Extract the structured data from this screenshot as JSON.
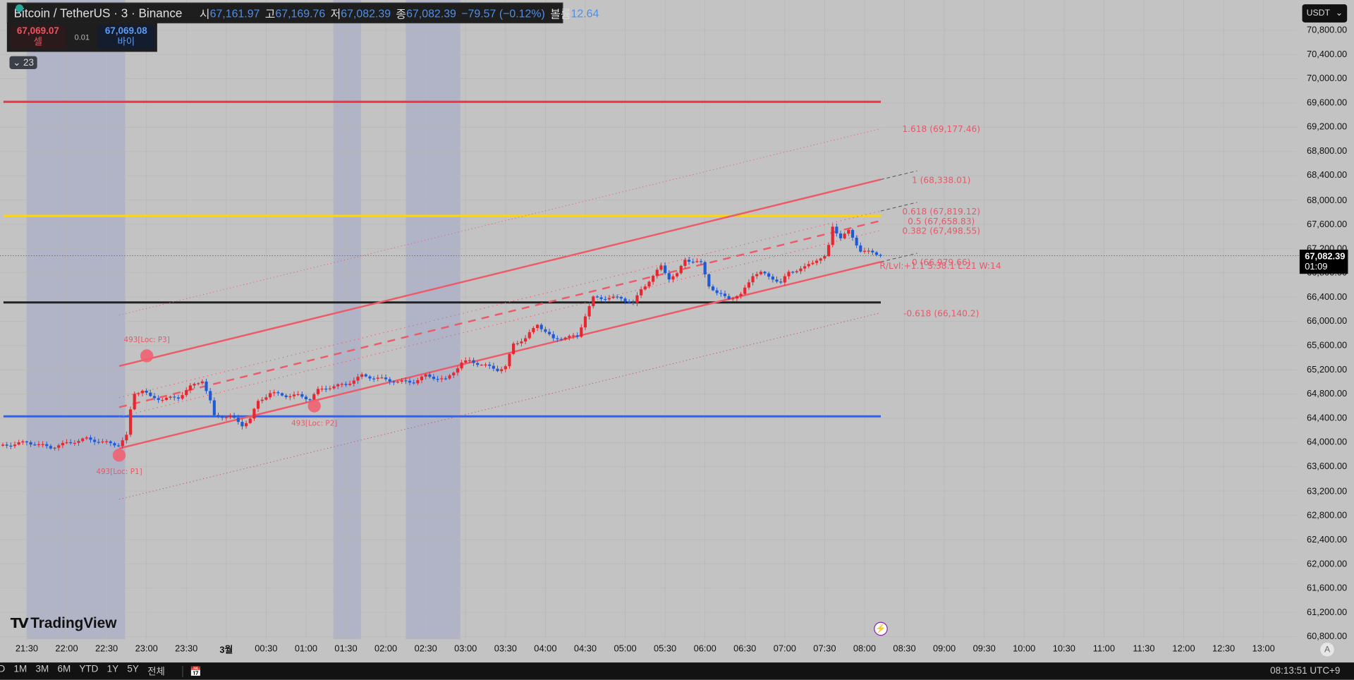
{
  "header": {
    "symbol": "Bitcoin / TetherUS · 3 · Binance",
    "open_label": "시",
    "open": "67,161.97",
    "high_label": "고",
    "high": "67,169.76",
    "low_label": "저",
    "low": "67,082.39",
    "close_label": "종",
    "close": "67,082.39",
    "change": "−79.57 (−0.12%)",
    "volume_label": "볼륨",
    "volume": "12.64"
  },
  "trade": {
    "sell_price": "67,069.07",
    "sell_label": "셀",
    "spread": "0.01",
    "buy_price": "67,069.08",
    "buy_label": "바이"
  },
  "indicators_pill": "23",
  "currency": "USDT",
  "current_price": {
    "price": "67,082.39",
    "countdown": "01:09",
    "value": 67082.39
  },
  "price_axis": [
    "70,800.00",
    "70,400.00",
    "70,000.00",
    "69,600.00",
    "69,200.00",
    "68,800.00",
    "68,400.00",
    "68,000.00",
    "67,600.00",
    "67,200.00",
    "66,800.00",
    "66,400.00",
    "66,000.00",
    "65,600.00",
    "65,200.00",
    "64,800.00",
    "64,400.00",
    "64,000.00",
    "63,600.00",
    "63,200.00",
    "62,800.00",
    "62,400.00",
    "62,000.00",
    "61,600.00",
    "61,200.00",
    "60,800.00"
  ],
  "time_axis": [
    "21:30",
    "22:00",
    "22:30",
    "23:00",
    "23:30",
    "3월",
    "00:30",
    "01:00",
    "01:30",
    "02:00",
    "02:30",
    "03:00",
    "03:30",
    "04:00",
    "04:30",
    "05:00",
    "05:30",
    "06:00",
    "06:30",
    "07:00",
    "07:30",
    "08:00",
    "08:30",
    "09:00",
    "09:30",
    "10:00",
    "10:30",
    "11:00",
    "11:30",
    "12:00",
    "12:30",
    "13:00"
  ],
  "horizontal_lines": [
    {
      "price": 69620,
      "color": "#f23645"
    },
    {
      "price": 67738,
      "color": "#ffd600"
    },
    {
      "price": 66311,
      "color": "#222222"
    },
    {
      "price": 64432,
      "color": "#2962ff"
    }
  ],
  "fib_labels": [
    {
      "text": "1.618 (69,177.46)",
      "price": 69177.46
    },
    {
      "text": "1 (68,338.01)",
      "price": 68338.01
    },
    {
      "text": "0.618 (67,819.12)",
      "price": 67819.12
    },
    {
      "text": "0.5 (67,658.83)",
      "price": 67658.83
    },
    {
      "text": "0.382 (67,498.55)",
      "price": 67498.55
    },
    {
      "text": "0 (66,979.66)",
      "price": 66979.66
    },
    {
      "text": "-0.618 (66,140.2)",
      "price": 66140.2
    }
  ],
  "channel_info": "R/Lvl:+1.1 S:38.1 L:21 W:14",
  "pivots": [
    {
      "label": "493[Loc: P1]"
    },
    {
      "label": "493[Loc: P2]"
    },
    {
      "label": "493[Loc: P3]"
    }
  ],
  "colors": {
    "up": "#e8262f",
    "down": "#1f5ad6",
    "channel": "#ee5a68",
    "background": "#c3c3c3",
    "session_band": "#b0b4c6"
  },
  "logo": "TradingView",
  "bottom_bar": {
    "ranges": [
      "D",
      "1M",
      "3M",
      "6M",
      "YTD",
      "1Y",
      "5Y",
      "전체"
    ],
    "clock": "08:13:51 UTC+9"
  },
  "chart_data": {
    "type": "candlestick",
    "interval": "3m",
    "ylim": [
      60800,
      70800
    ],
    "price_path": [
      [
        "21:12",
        63948
      ],
      [
        "21:30",
        64005
      ],
      [
        "21:48",
        63920
      ],
      [
        "22:03",
        64005
      ],
      [
        "22:15",
        64062
      ],
      [
        "22:27",
        64005
      ],
      [
        "22:39",
        63962
      ],
      [
        "22:45",
        64105
      ],
      [
        "22:48",
        64532
      ],
      [
        "22:51",
        64817
      ],
      [
        "22:57",
        64860
      ],
      [
        "23:03",
        64746
      ],
      [
        "23:12",
        64718
      ],
      [
        "23:24",
        64746
      ],
      [
        "23:33",
        64917
      ],
      [
        "23:42",
        65031
      ],
      [
        "23:48",
        64675
      ],
      [
        "23:51",
        64433
      ],
      [
        "00:03",
        64433
      ],
      [
        "00:12",
        64290
      ],
      [
        "00:18",
        64390
      ],
      [
        "00:24",
        64675
      ],
      [
        "00:33",
        64817
      ],
      [
        "00:45",
        64774
      ],
      [
        "00:54",
        64774
      ],
      [
        "01:03",
        64718
      ],
      [
        "01:09",
        64860
      ],
      [
        "01:18",
        64917
      ],
      [
        "01:30",
        64960
      ],
      [
        "01:42",
        65102
      ],
      [
        "01:54",
        65059
      ],
      [
        "02:09",
        65002
      ],
      [
        "02:21",
        65002
      ],
      [
        "02:30",
        65102
      ],
      [
        "02:45",
        65031
      ],
      [
        "02:57",
        65316
      ],
      [
        "03:03",
        65344
      ],
      [
        "03:12",
        65287
      ],
      [
        "03:24",
        65202
      ],
      [
        "03:30",
        65244
      ],
      [
        "03:36",
        65629
      ],
      [
        "03:45",
        65715
      ],
      [
        "03:54",
        65957
      ],
      [
        "04:06",
        65700
      ],
      [
        "04:15",
        65743
      ],
      [
        "04:24",
        65743
      ],
      [
        "04:30",
        66099
      ],
      [
        "04:36",
        66384
      ],
      [
        "04:45",
        66384
      ],
      [
        "04:57",
        66384
      ],
      [
        "05:06",
        66284
      ],
      [
        "05:12",
        66526
      ],
      [
        "05:21",
        66740
      ],
      [
        "05:27",
        66911
      ],
      [
        "05:33",
        66712
      ],
      [
        "05:39",
        66769
      ],
      [
        "05:45",
        67025
      ],
      [
        "05:57",
        66954
      ],
      [
        "06:03",
        66598
      ],
      [
        "06:09",
        66455
      ],
      [
        "06:18",
        66384
      ],
      [
        "06:27",
        66427
      ],
      [
        "06:36",
        66769
      ],
      [
        "06:42",
        66797
      ],
      [
        "06:51",
        66712
      ],
      [
        "06:57",
        66626
      ],
      [
        "07:03",
        66811
      ],
      [
        "07:15",
        66883
      ],
      [
        "07:24",
        67025
      ],
      [
        "07:30",
        67054
      ],
      [
        "07:33",
        67239
      ],
      [
        "07:36",
        67566
      ],
      [
        "07:42",
        67381
      ],
      [
        "07:48",
        67481
      ],
      [
        "07:57",
        67168
      ],
      [
        "08:03",
        67139
      ],
      [
        "08:09",
        67111
      ],
      [
        "08:12",
        67082.39
      ]
    ]
  }
}
